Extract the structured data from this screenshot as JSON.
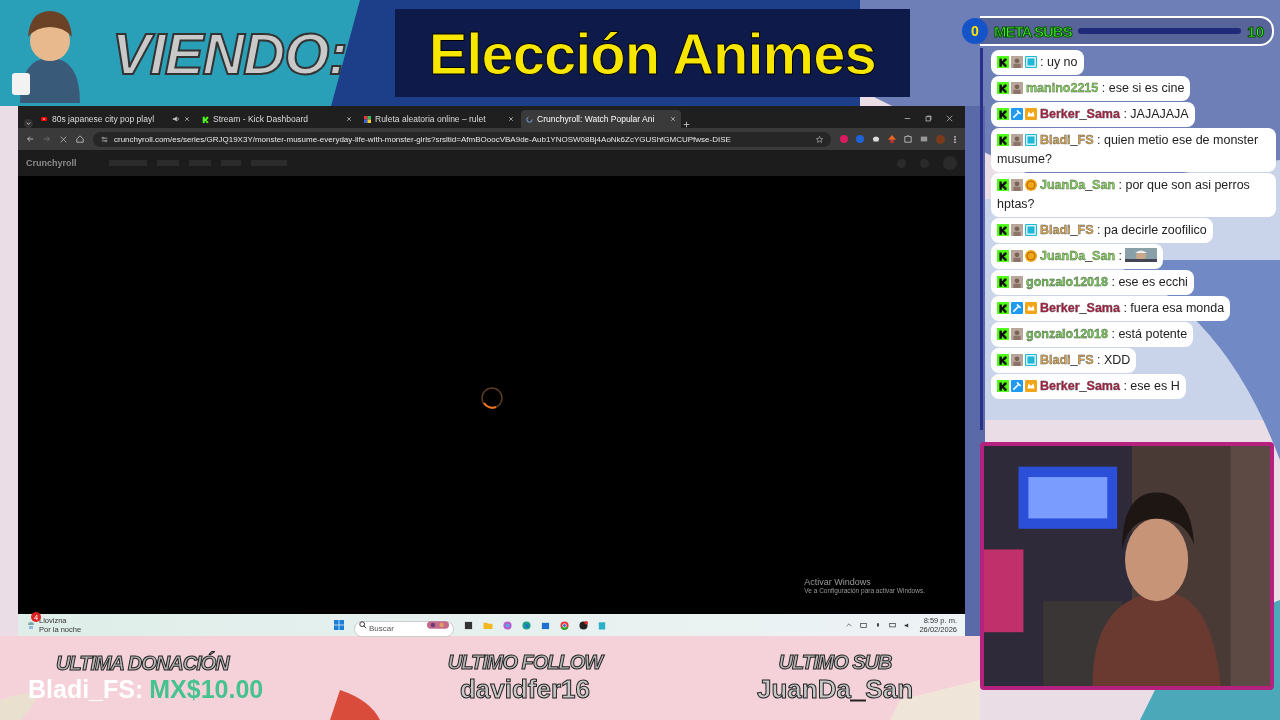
{
  "header": {
    "viewing_label": "VIENDO:",
    "title": "Elección Animes"
  },
  "goal": {
    "count": "0",
    "label": "META SUBS",
    "target": "10",
    "level": 0
  },
  "browser": {
    "tabs": [
      {
        "title": "80s japanese city pop playl",
        "audio": true,
        "selected": false
      },
      {
        "title": "Stream - Kick Dashboard",
        "audio": false,
        "selected": false
      },
      {
        "title": "Ruleta aleatoria online – rulet",
        "audio": false,
        "selected": false
      },
      {
        "title": "Crunchyroll: Watch Popular Ani",
        "audio": false,
        "selected": true
      }
    ],
    "url": "crunchyroll.com/es/series/GRJQ19X3Y/monster-musume-everyday-life-with-monster-girls?srsltid=AfmBOoocVBA9de-Aub1YNOSW08Bj4AoNk6ZcYGUShfGMCUPfwse-DISE",
    "site_logo": "Crunchyroll",
    "watermark": {
      "title": "Activar Windows",
      "subtitle": "Ve a Configuración para activar Windows."
    }
  },
  "taskbar": {
    "weather": {
      "badge": "4",
      "condition": "Llovizna",
      "period": "Por la noche"
    },
    "search": {
      "placeholder": "Buscar"
    },
    "time": "8:59 p. m.",
    "date": "26/02/2026"
  },
  "chat": [
    {
      "text": ": uy no",
      "emote": false
    },
    {
      "user": "manino2215",
      "color": "#7fd94f",
      "text": ": ese si es cine",
      "emote": false
    },
    {
      "user": "Berker_Sama",
      "color": "#b3173f",
      "text": ": JAJAJAJA",
      "emote": false
    },
    {
      "user": "Bladi_FS",
      "color": "#d9a54c",
      "text": ": quien metio ese de monster musume?",
      "emote": false
    },
    {
      "user": "JuanDa_San",
      "color": "#7fd94f",
      "text": ": por que son asi perros hptas?",
      "emote": false
    },
    {
      "user": "Bladi_FS",
      "color": "#d9a54c",
      "text": ": pa decirle zoofilico",
      "emote": false
    },
    {
      "user": "JuanDa_San",
      "color": "#7fd94f",
      "text": ":",
      "emote": true
    },
    {
      "user": "gonzalo12018",
      "color": "#6cc94a",
      "text": ": ese es ecchi",
      "emote": false
    },
    {
      "user": "Berker_Sama",
      "color": "#b3173f",
      "text": ": fuera esa monda",
      "emote": false
    },
    {
      "user": "gonzalo12018",
      "color": "#6cc94a",
      "text": ": está potente",
      "emote": false
    },
    {
      "user": "Bladi_FS",
      "color": "#d9a54c",
      "text": ": XDD",
      "emote": false
    },
    {
      "user": "Berker_Sama",
      "color": "#b3173f",
      "text": ": ese es H",
      "emote": false
    }
  ],
  "footer": [
    {
      "label": "ULTIMA DONACIÓN",
      "user": "Bladi_FS:",
      "amount": "MX$10.00"
    },
    {
      "label": "ULTIMO FOLLOW",
      "user": "davidfer16"
    },
    {
      "label": "ULTIMO SUB",
      "user": "JuanDa_San"
    }
  ]
}
